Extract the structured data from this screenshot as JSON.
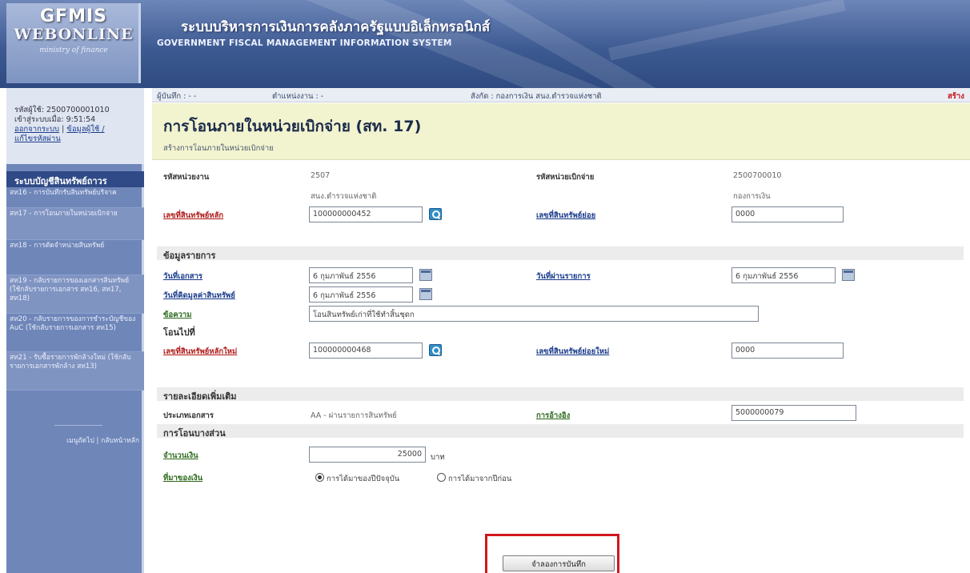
{
  "header": {
    "logo_line1": "GFMIS",
    "logo_line2": "WEBONLINE",
    "logo_line3": "ministry of finance",
    "title_th": "ระบบบริหารการเงินการคลังภาครัฐแบบอิเล็กทรอนิกส์",
    "title_en": "GOVERNMENT FISCAL MANAGEMENT INFORMATION SYSTEM"
  },
  "sidebar": {
    "user_id": "รหัสผู้ใช้: 2500700001010",
    "login_time": "เข้าสู่ระบบเมื่อ: 9:51:54",
    "logout_link": "ออกจากระบบ",
    "profile_link": "ข้อมูลผู้ใช้ /",
    "password_link": "แก้ไขรหัสผ่าน",
    "heading": "ระบบบัญชีสินทรัพย์ถาวร",
    "items": [
      "สท16 - การบันทึกรับสินทรัพย์บริจาค",
      "สท17 - การโอนภายในหน่วยเบิกจ่าย",
      "สท18 - การตัดจำหน่ายสินทรัพย์",
      "สท19 - กลับรายการของเอกสารสินทรัพย์ (ใช้กลับรายการเอกสาร สท16, สท17, สท18)",
      "สท20 - กลับรายการของการชำระบัญชีของ AuC (ใช้กลับรายการเอกสาร สท15)",
      "สท21 - รับซื้อรายการพักล้างใหม่ (ใช้กลับรายการเอกสารพักล้าง สท13)"
    ],
    "footer_link": "เมนูถัดไป | กลับหน้าหลัก"
  },
  "topbar": {
    "recorder": "ผู้บันทึก : - -",
    "unit": "ตำแหน่งงาน : -",
    "affiliation": "สังกัด : กองการเงิน สนง.ตำรวจแห่งชาติ",
    "create": "สร้าง"
  },
  "page": {
    "title": "การโอนภายในหน่วยเบิกจ่าย (สท. 17)",
    "subtitle": "สร้างการโอนภายในหน่วยเบิกจ่าย"
  },
  "form": {
    "agency_code_label": "รหัสหน่วยงาน",
    "agency_code": "2507",
    "agency_name": "สนง.ตำรวจแห่งชาติ",
    "disbursing_unit_label": "รหัสหน่วยเบิกจ่าย",
    "disbursing_unit": "2500700010",
    "disbursing_unit_name": "กองการเงิน",
    "main_asset_label": "เลขที่สินทรัพย์หลัก",
    "main_asset_value": "100000000452",
    "sub_asset_label": "เลขที่สินทรัพย์ย่อย",
    "sub_asset_value": "0000",
    "section_details": "ข้อมูลรายการ",
    "doc_date_label": "วันที่เอกสาร",
    "doc_date_value": "6 กุมภาพันธ์ 2556",
    "posting_date_label": "วันที่ผ่านรายการ",
    "posting_date_value": "6 กุมภาพันธ์ 2556",
    "asset_value_date_label": "วันที่คิดมูลค่าสินทรัพย์",
    "asset_value_date_value": "6 กุมภาพันธ์ 2556",
    "text_label": "ข้อความ",
    "text_value": "โอนสินทรัพย์เก่าที่ใช้ทำสิ้นชุดก",
    "section_transfer_to": "โอนไปที่",
    "new_main_asset_label": "เลขที่สินทรัพย์หลักใหม่",
    "new_main_asset_value": "100000000468",
    "new_sub_asset_label": "เลขที่สินทรัพย์ย่อยใหม่",
    "new_sub_asset_value": "0000",
    "section_more": "รายละเอียดเพิ่มเติม",
    "doc_type_label": "ประเภทเอกสาร",
    "doc_type_value": "AA - ผ่านรายการสินทรัพย์",
    "reference_label": "การอ้างอิง",
    "reference_value": "5000000079",
    "section_partial": "การโอนบางส่วน",
    "amount_label": "จำนวนเงิน",
    "amount_value": "25000",
    "amount_unit": "บาท",
    "origin_label": "ที่มาของเงิน",
    "origin_option1": "การได้มาของปีปัจจุบัน",
    "origin_option2": "การได้มาจากปีก่อน",
    "save_button": "จำลองการบันทึก"
  },
  "colors": {
    "highlight": "#d0171d",
    "title_band": "#f2f4cf",
    "sidebar": "#6f86b9"
  }
}
